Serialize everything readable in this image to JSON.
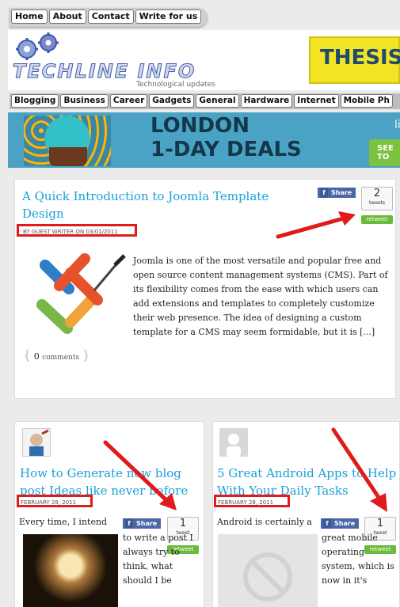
{
  "top_nav": [
    "Home",
    "About",
    "Contact",
    "Write for us"
  ],
  "logo": {
    "text": "TECHLINE INFO",
    "tagline": "Technological updates"
  },
  "header_ad": {
    "text": "THESIS"
  },
  "categories": [
    "Blogging",
    "Business",
    "Career",
    "Gadgets",
    "General",
    "Hardware",
    "Internet",
    "Mobile Ph"
  ],
  "banner": {
    "line1": "LONDON",
    "line2": "1-DAY DEALS",
    "side": "liv",
    "button": "SEE TO"
  },
  "posts": [
    {
      "title": "A Quick Introduction to Joomla Template Design",
      "meta": "by GUEST WRITER on 03/01/2011",
      "excerpt": "Joomla is one of the most versatile and popular free and open source content management systems (CMS). Part of its flexibility comes from the ease with which users can add extensions and templates to completely customize their web presence. The idea of designing a custom template for a CMS may seem formidable, but it is [...]",
      "share": "Share",
      "tweets": "2",
      "tweets_label": "tweets",
      "retweet": "retweet",
      "comments_count": "0",
      "comments_label": "comments"
    },
    {
      "title": "How to Generate new blog post Ideas like never before",
      "meta": "FEBRUARY 28, 2011",
      "excerpt_first": "Every time, I intend",
      "excerpt": "to write a post I always try to think, what should I be",
      "share": "Share",
      "tweets": "1",
      "tweets_label": "tweet",
      "retweet": "retweet"
    },
    {
      "title": "5 Great Android Apps to Help With Your Daily Tasks",
      "meta": "FEBRUARY 28, 2011",
      "excerpt_first": "Android is certainly a",
      "excerpt": "great mobile operating system, which is now in it's",
      "share": "Share",
      "tweets": "1",
      "tweets_label": "tweet",
      "retweet": "retweet"
    }
  ],
  "colors": {
    "link": "#1aa0d8",
    "annotation": "#e01b1b",
    "share": "#4a67a6",
    "retweet": "#6cba3b"
  }
}
